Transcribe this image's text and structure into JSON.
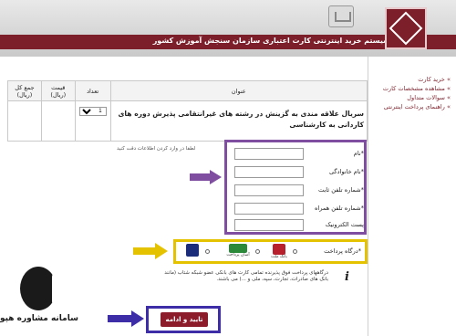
{
  "header": {
    "title": "سیستم خرید اینترنتی کارت اعتباری سازمان سنجش آموزش کشور"
  },
  "sidebar": {
    "items": [
      {
        "label": "خرید کارت"
      },
      {
        "label": "مشاهده مشخصات کارت"
      },
      {
        "label": "سوالات متداول"
      },
      {
        "label": "راهنمای پرداخت اینترنتی"
      }
    ]
  },
  "cart_table": {
    "headers": {
      "title": "عنوان",
      "count": "تعداد",
      "price": "قیمت (ریال)",
      "total": "جمع کل (ریال)"
    },
    "row": {
      "title": "سریال علاقه مندی به گزینش در رشته های غیرانتقامی پذیرش دوره های کاردانی به کارشناسی",
      "count": "1"
    }
  },
  "form": {
    "hint": "لطفا در وارد کردن اطلاعات دقت کنید",
    "fields": {
      "name": "*نام",
      "family": "*نام خانوادگی",
      "phone": "*شماره تلفن ثابت",
      "mobile": "*شماره تلفن همراه",
      "email": "پست الکترونیک"
    }
  },
  "gateway": {
    "label": "*درگاه پرداخت",
    "banks": [
      "بانک ملت",
      "آسان پرداخت",
      "پرداخت ملت"
    ]
  },
  "note": "درگاههای پرداخت فوق پذیرنده تمامی کارت های بانکی عضو شبکه شتاب (مانند بانک های صادرات، تجارت، سپه، ملی و ...) می باشند.",
  "submit": {
    "label": "تایید و ادامه"
  },
  "watermark": {
    "text": "سامانه مشاوره هپوا"
  }
}
